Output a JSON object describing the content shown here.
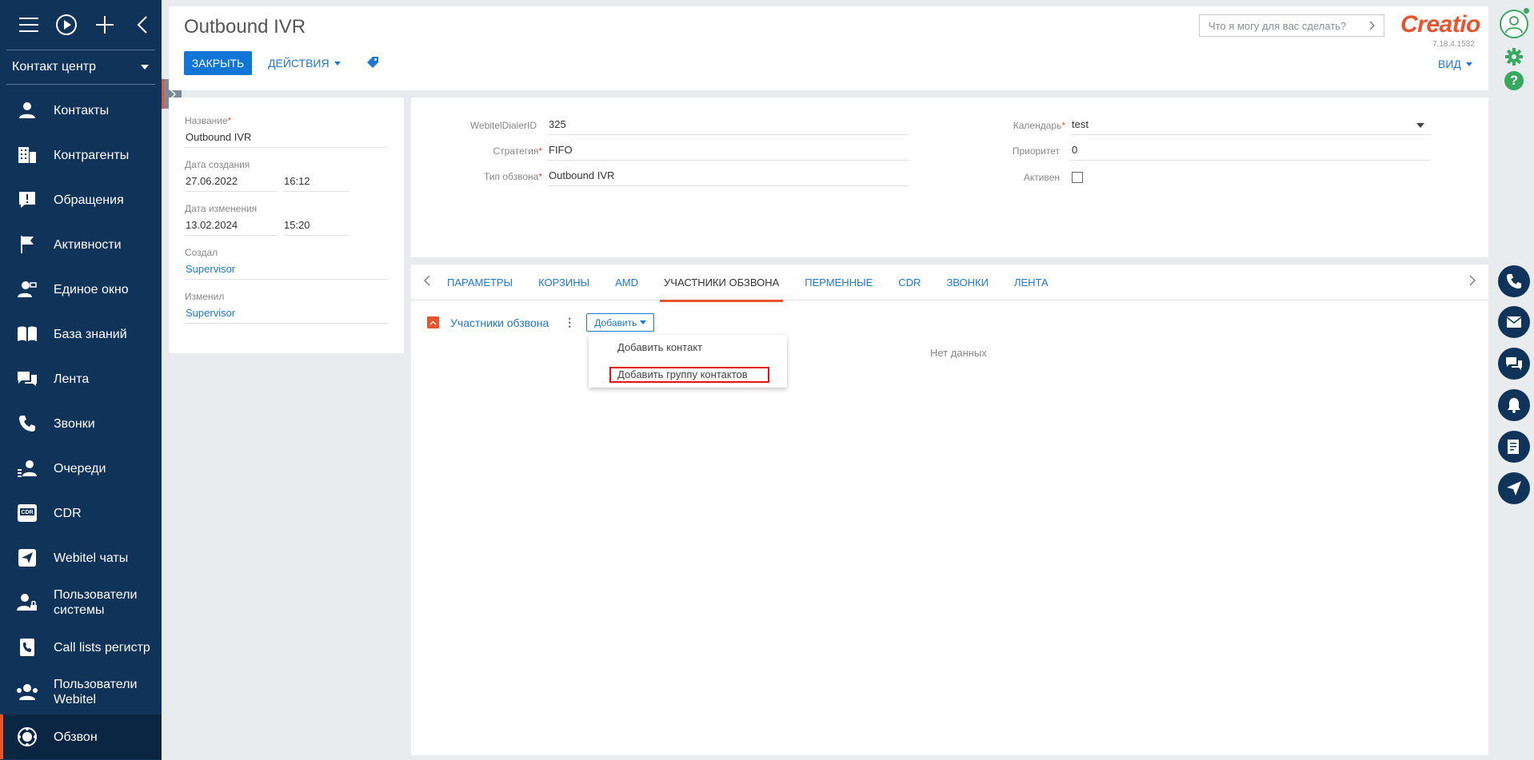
{
  "sidebar": {
    "workspace": "Контакт центр",
    "items": [
      {
        "label": "Контакты",
        "icon": "person-icon"
      },
      {
        "label": "Контрагенты",
        "icon": "building-icon"
      },
      {
        "label": "Обращения",
        "icon": "alert-icon"
      },
      {
        "label": "Активности",
        "icon": "flag-icon"
      },
      {
        "label": "Единое окно",
        "icon": "person-window-icon"
      },
      {
        "label": "База знаний",
        "icon": "book-icon"
      },
      {
        "label": "Лента",
        "icon": "feed-icon"
      },
      {
        "label": "Звонки",
        "icon": "phone-icon"
      },
      {
        "label": "Очереди",
        "icon": "queue-icon"
      },
      {
        "label": "CDR",
        "icon": "cdr-icon"
      },
      {
        "label": "Webitel чаты",
        "icon": "send-icon"
      },
      {
        "label": "Пользователи системы",
        "icon": "user-lock-icon"
      },
      {
        "label": "Call lists регистр",
        "icon": "call-list-icon"
      },
      {
        "label": "Пользователи Webitel",
        "icon": "users-icon"
      },
      {
        "label": "Обзвон",
        "icon": "dialer-icon"
      }
    ]
  },
  "header": {
    "title": "Outbound IVR",
    "close_label": "ЗАКРЫТЬ",
    "actions_label": "ДЕЙСТВИЯ",
    "search_placeholder": "Что я могу для вас сделать?",
    "logo": "Creatio",
    "version": "7.18.4.1532",
    "view_label": "ВИД"
  },
  "info": {
    "name_label": "Название",
    "name_value": "Outbound IVR",
    "created_label": "Дата создания",
    "created_date": "27.06.2022",
    "created_time": "16:12",
    "modified_label": "Дата изменения",
    "modified_date": "13.02.2024",
    "modified_time": "15:20",
    "created_by_label": "Создал",
    "created_by": "Supervisor",
    "modified_by_label": "Изменил",
    "modified_by": "Supervisor"
  },
  "fields": {
    "dialer_id_label": "WebitelDialerID",
    "dialer_id": "325",
    "strategy_label": "Стратегия",
    "strategy": "FIFO",
    "type_label": "Тип обзвона",
    "type": "Outbound IVR",
    "calendar_label": "Календарь",
    "calendar": "test",
    "priority_label": "Приоритет",
    "priority": "0",
    "active_label": "Активен"
  },
  "tabs": [
    "ПАРАМЕТРЫ",
    "КОРЗИНЫ",
    "AMD",
    "УЧАСТНИКИ ОБЗВОНА",
    "ПЕРМЕННЫЕ",
    "CDR",
    "ЗВОНКИ",
    "ЛЕНТА"
  ],
  "detail": {
    "title": "Участники обзвона",
    "add_label": "Добавить",
    "no_data": "Нет данных",
    "menu": [
      "Добавить контакт",
      "Добавить группу контактов"
    ]
  },
  "colors": {
    "sidebar": "#10335a",
    "accent": "#e8542e",
    "link": "#1e78d0",
    "primary_button": "#0f76d7",
    "highlight": "#e8101d"
  }
}
